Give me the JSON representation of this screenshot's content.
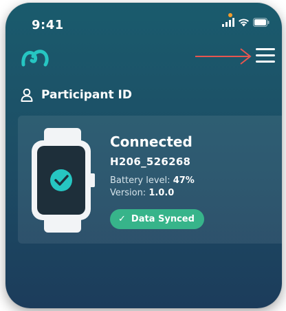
{
  "status_bar": {
    "time": "9:41",
    "icons": [
      "signal-icon",
      "wifi-icon",
      "battery-icon"
    ]
  },
  "header": {
    "logo": "app-logo",
    "menu_icon": "hamburger-menu-icon",
    "arrow_color": "#e8564f",
    "accent_color": "#26c6c2"
  },
  "participant": {
    "label": "Participant ID"
  },
  "device_card": {
    "status": "Connected",
    "device_id": "H206_526268",
    "battery_label": "Battery level:",
    "battery_value": "47%",
    "version_label": "Version:",
    "version_value": "1.0.0",
    "sync_badge": "Data Synced",
    "sync_color": "#37b48a"
  }
}
